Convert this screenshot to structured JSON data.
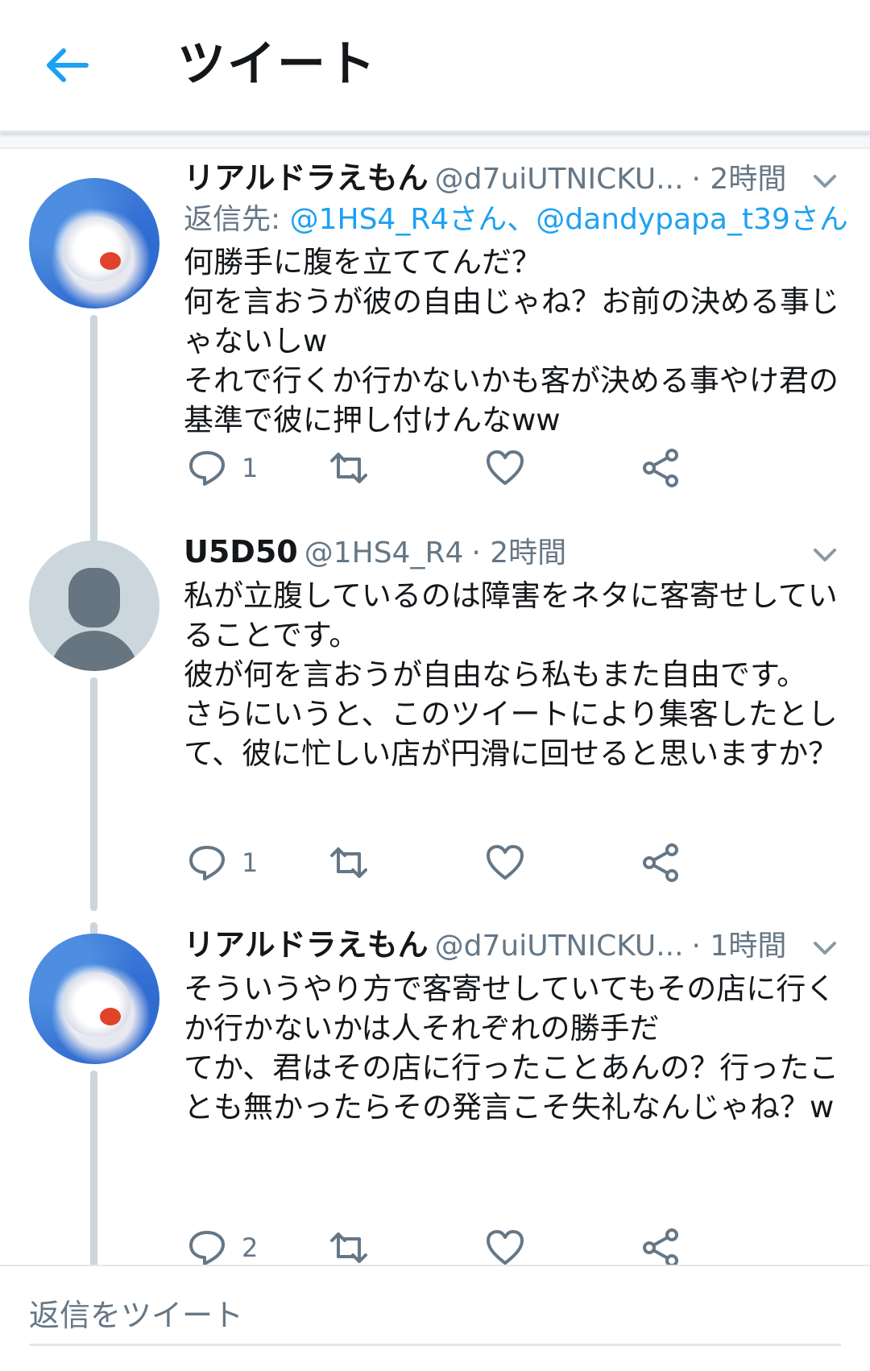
{
  "header": {
    "title": "ツイート",
    "back_icon": "arrow-left-icon",
    "accent_color": "#1da1f2"
  },
  "tweets": [
    {
      "display_name": "リアルドラえもん",
      "handle": "@d7uiUTNICKU...",
      "time": "· 2時間",
      "reply_to_label": "返信先:",
      "reply_to_mentions": "@1HS4_R4さん、@dandypapa_t39さん",
      "text": "何勝手に腹を立ててんだ？\n何を言おうが彼の自由じゃね？お前の決める事じゃないしw\nそれで行くか行かないかも客が決める事やけ君の基準で彼に押し付けんなww",
      "reply_count": "1"
    },
    {
      "display_name": "U5D50",
      "handle": "@1HS4_R4",
      "time": "· 2時間",
      "text": "私が立腹しているのは障害をネタに客寄せしていることです。\n彼が何を言おうが自由なら私もまた自由です。\nさらにいうと、このツイートにより集客したとして、彼に忙しい店が円滑に回せると思いますか？",
      "reply_count": "1"
    },
    {
      "display_name": "リアルドラえもん",
      "handle": "@d7uiUTNICKU...",
      "time": "· 1時間",
      "text": "そういうやり方で客寄せしていてもその店に行くか行かないかは人それぞれの勝手だ\nてか、君はその店に行ったことあんの？行ったことも無かったらその発言こそ失礼なんじゃね？w",
      "reply_count": "2"
    }
  ],
  "reply_bar": {
    "placeholder": "返信をツイート"
  }
}
